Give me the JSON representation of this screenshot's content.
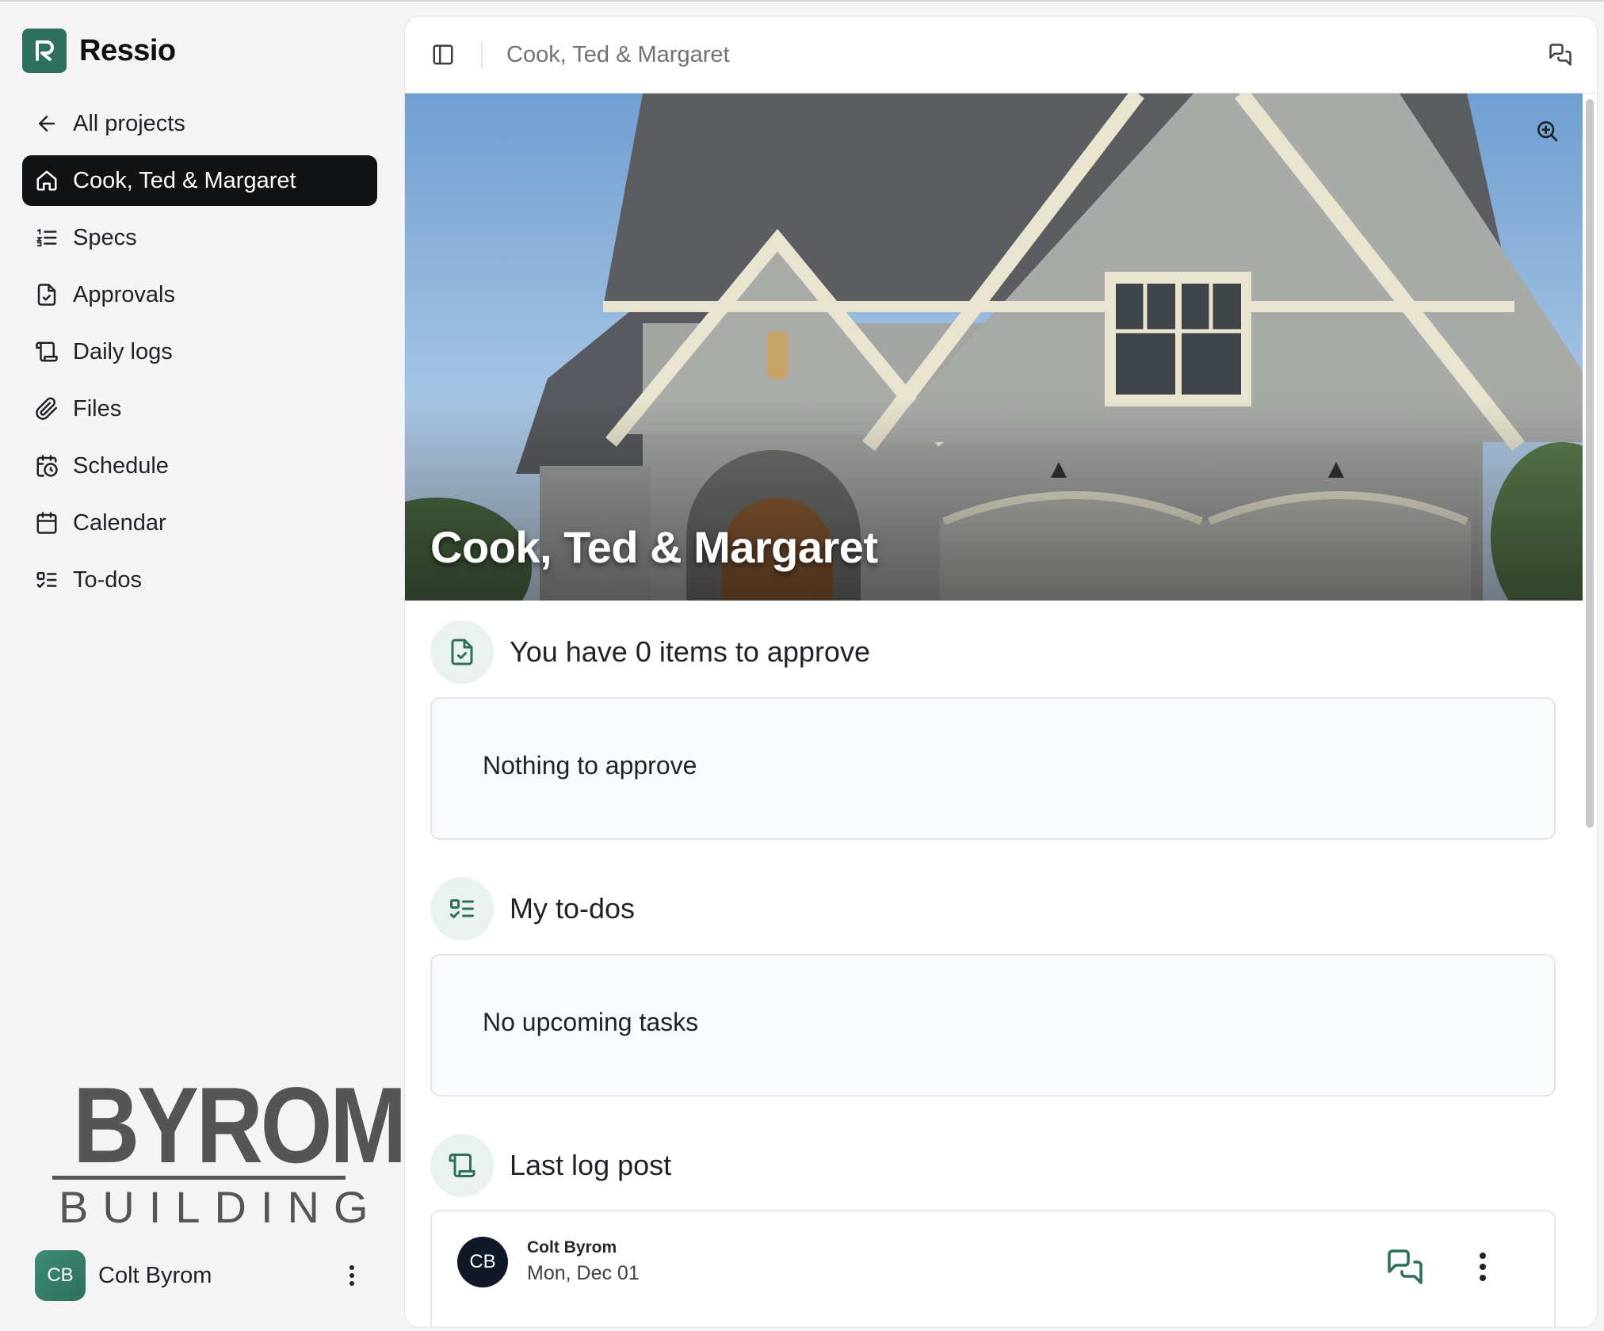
{
  "app": {
    "name": "Ressio"
  },
  "sidebar": {
    "items": [
      {
        "label": "All projects",
        "icon": "arrow-left-icon"
      },
      {
        "label": "Cook, Ted & Margaret",
        "icon": "home-icon",
        "active": true
      },
      {
        "label": "Specs",
        "icon": "list-ordered-icon"
      },
      {
        "label": "Approvals",
        "icon": "file-check-icon"
      },
      {
        "label": "Daily logs",
        "icon": "scroll-icon"
      },
      {
        "label": "Files",
        "icon": "paperclip-icon"
      },
      {
        "label": "Schedule",
        "icon": "calendar-clock-icon"
      },
      {
        "label": "Calendar",
        "icon": "calendar-icon"
      },
      {
        "label": "To-dos",
        "icon": "list-todo-icon"
      }
    ],
    "company_logo": {
      "line1": "BYROM",
      "line2": "BUILDING"
    },
    "user": {
      "initials": "CB",
      "name": "Colt Byrom"
    }
  },
  "header": {
    "breadcrumb": "Cook, Ted & Margaret"
  },
  "hero": {
    "title": "Cook, Ted & Margaret"
  },
  "approvals": {
    "title": "You have 0 items to approve",
    "empty": "Nothing to approve"
  },
  "todos": {
    "title": "My to-dos",
    "empty": "No upcoming tasks"
  },
  "last_log": {
    "title": "Last log post",
    "author_initials": "CB",
    "author": "Colt Byrom",
    "date": "Mon, Dec 01"
  },
  "colors": {
    "brand": "#2f6f5e",
    "active_nav": "#111214",
    "icon_tint": "#2f6f5e",
    "icon_bg": "#e9f2ef"
  }
}
